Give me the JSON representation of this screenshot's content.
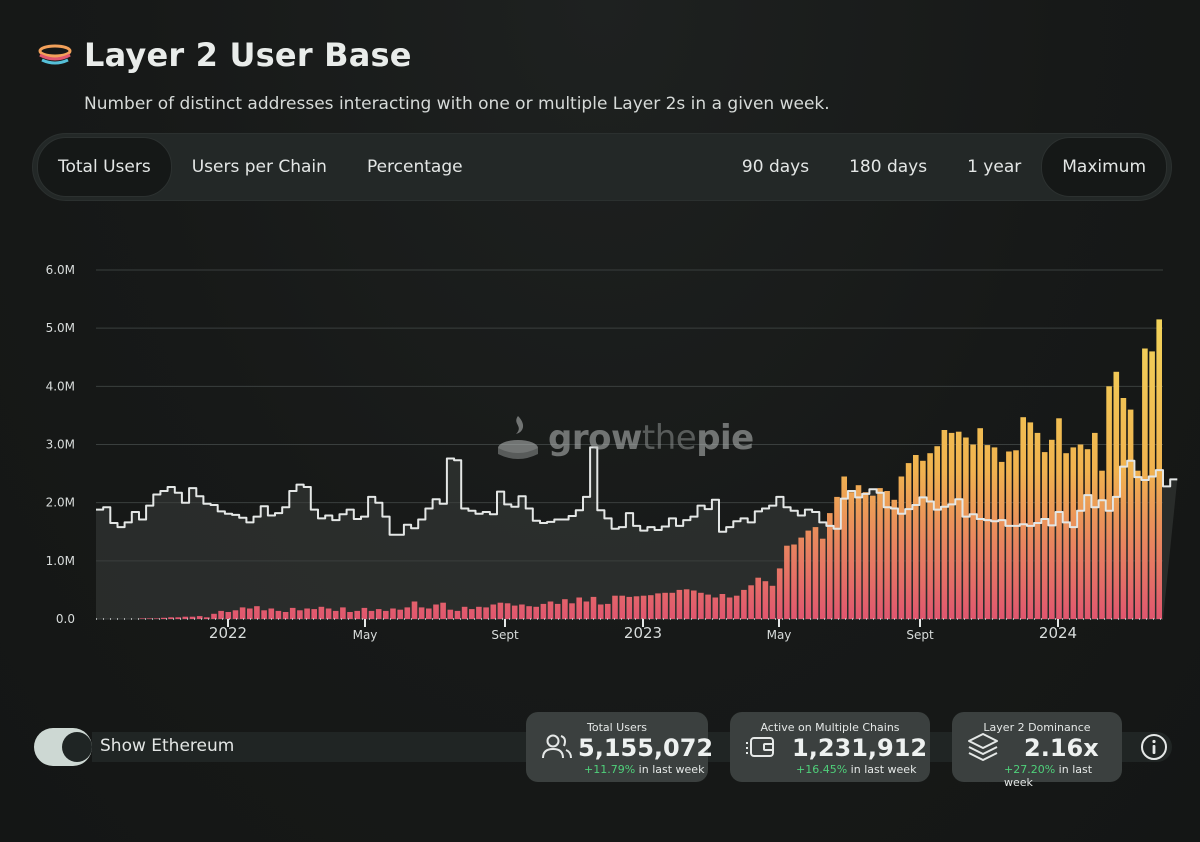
{
  "header": {
    "title": "Layer 2 User Base",
    "subtitle": "Number of distinct addresses interacting with one or multiple Layer 2s in a given week."
  },
  "tabs_left": [
    {
      "label": "Total Users",
      "active": true
    },
    {
      "label": "Users per Chain",
      "active": false
    },
    {
      "label": "Percentage",
      "active": false
    }
  ],
  "tabs_right": [
    {
      "label": "90 days",
      "active": false
    },
    {
      "label": "180 days",
      "active": false
    },
    {
      "label": "1 year",
      "active": false
    },
    {
      "label": "Maximum",
      "active": true
    }
  ],
  "watermark": {
    "grow": "grow",
    "the": "the",
    "pie": "pie"
  },
  "toggle": {
    "label": "Show Ethereum",
    "on": true
  },
  "metrics": [
    {
      "label": "Total Users",
      "value": "5,155,072",
      "change": "+11.79%",
      "suffix": "in last week",
      "icon": "users-icon"
    },
    {
      "label": "Active on Multiple Chains",
      "value": "1,231,912",
      "change": "+16.45%",
      "suffix": "in last week",
      "icon": "wallet-icon"
    },
    {
      "label": "Layer 2 Dominance",
      "value": "2.16x",
      "change": "+27.20%",
      "suffix": "in last week",
      "icon": "layers-icon"
    }
  ],
  "colors": {
    "bar_top": "#f2d35a",
    "bar_bottom": "#e0566f",
    "ethereum_line": "#e4e7e6",
    "ethereum_fill": "#3b3e3d",
    "positive": "#4fd07a"
  },
  "chart_data": {
    "type": "bar",
    "ylim": [
      0,
      6.0
    ],
    "yticks": [
      "0.0",
      "1.0M",
      "2.0M",
      "3.0M",
      "4.0M",
      "5.0M",
      "6.0M"
    ],
    "xtick_labels": [
      "2022",
      "May",
      "Sept",
      "2023",
      "May",
      "Sept",
      "2024"
    ],
    "grid": true,
    "series": [
      {
        "name": "Layer 2",
        "values": [
          0.0,
          0.0,
          0.0,
          0.0,
          0.0,
          0.0,
          0.01,
          0.01,
          0.01,
          0.02,
          0.03,
          0.03,
          0.04,
          0.04,
          0.05,
          0.03,
          0.09,
          0.14,
          0.12,
          0.15,
          0.2,
          0.18,
          0.22,
          0.15,
          0.18,
          0.14,
          0.12,
          0.19,
          0.15,
          0.18,
          0.17,
          0.21,
          0.18,
          0.14,
          0.2,
          0.12,
          0.14,
          0.19,
          0.14,
          0.17,
          0.14,
          0.18,
          0.16,
          0.2,
          0.3,
          0.2,
          0.18,
          0.25,
          0.28,
          0.16,
          0.14,
          0.21,
          0.17,
          0.21,
          0.2,
          0.25,
          0.28,
          0.27,
          0.23,
          0.25,
          0.22,
          0.21,
          0.26,
          0.3,
          0.26,
          0.34,
          0.27,
          0.37,
          0.3,
          0.38,
          0.25,
          0.26,
          0.4,
          0.4,
          0.38,
          0.39,
          0.4,
          0.41,
          0.44,
          0.45,
          0.45,
          0.5,
          0.51,
          0.49,
          0.45,
          0.42,
          0.37,
          0.43,
          0.37,
          0.4,
          0.5,
          0.58,
          0.71,
          0.65,
          0.57,
          0.87,
          1.26,
          1.28,
          1.4,
          1.52,
          1.58,
          1.38,
          1.82,
          2.1,
          2.45,
          2.18,
          2.3,
          2.18,
          2.12,
          2.25,
          2.2,
          2.05,
          2.45,
          2.68,
          2.82,
          2.72,
          2.85,
          2.97,
          3.25,
          3.2,
          3.22,
          3.12,
          3.0,
          3.28,
          2.99,
          2.95,
          2.7,
          2.88,
          2.9,
          3.47,
          3.38,
          3.2,
          2.87,
          3.08,
          3.45,
          2.85,
          2.95,
          3.0,
          2.92,
          3.2,
          2.55,
          4.0,
          4.25,
          3.8,
          3.6,
          2.55,
          4.65,
          4.6,
          5.15
        ]
      },
      {
        "name": "Ethereum",
        "values": [
          1.88,
          1.92,
          1.65,
          1.58,
          1.66,
          1.84,
          1.71,
          1.95,
          2.14,
          2.2,
          2.27,
          2.17,
          2.0,
          2.25,
          2.11,
          1.98,
          1.96,
          1.85,
          1.81,
          1.79,
          1.74,
          1.66,
          1.76,
          1.94,
          1.78,
          1.82,
          1.92,
          2.2,
          2.31,
          2.27,
          1.88,
          1.73,
          1.78,
          1.7,
          1.8,
          1.88,
          1.72,
          1.76,
          2.1,
          2.0,
          1.76,
          1.45,
          1.45,
          1.62,
          1.56,
          1.71,
          1.9,
          2.06,
          1.98,
          2.76,
          2.73,
          1.9,
          1.86,
          1.81,
          1.84,
          1.8,
          2.19,
          1.97,
          1.93,
          2.11,
          1.9,
          1.69,
          1.65,
          1.67,
          1.71,
          1.71,
          1.77,
          1.87,
          2.1,
          2.95,
          1.87,
          1.73,
          1.55,
          1.58,
          1.82,
          1.6,
          1.52,
          1.58,
          1.53,
          1.59,
          1.73,
          1.6,
          1.7,
          1.76,
          1.95,
          1.89,
          2.05,
          1.5,
          1.58,
          1.68,
          1.73,
          1.66,
          1.85,
          1.9,
          1.95,
          2.1,
          1.92,
          1.86,
          1.78,
          1.88,
          1.84,
          1.66,
          1.6,
          1.55,
          2.07,
          2.2,
          2.09,
          2.15,
          2.23,
          2.17,
          1.92,
          1.9,
          1.81,
          1.89,
          1.96,
          2.09,
          2.02,
          1.88,
          1.93,
          1.97,
          2.06,
          1.76,
          1.8,
          1.72,
          1.7,
          1.68,
          1.7,
          1.6,
          1.6,
          1.63,
          1.6,
          1.65,
          1.72,
          1.61,
          1.84,
          1.66,
          1.58,
          1.86,
          2.13,
          1.92,
          2.04,
          1.86,
          2.1,
          2.62,
          2.72,
          2.44,
          2.39,
          2.45,
          2.56,
          2.28,
          2.4
        ]
      }
    ]
  }
}
